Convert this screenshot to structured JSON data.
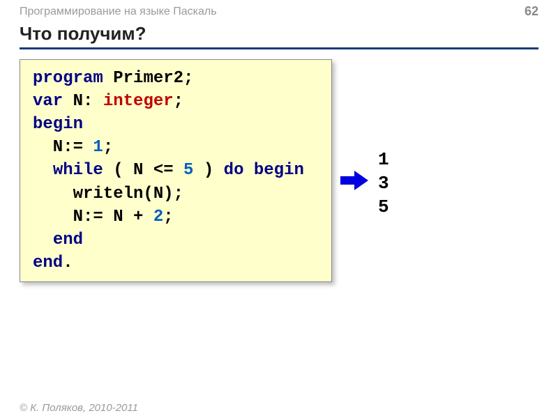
{
  "header": {
    "subject": "Программирование на языке Паскаль",
    "page": "62"
  },
  "title": "Что получим?",
  "code": {
    "l1_kw": "program",
    "l1_rest": " Primer2;",
    "l2_kw": "var",
    "l2_mid": " N: ",
    "l2_type": "integer",
    "l2_end": ";",
    "l3_kw": "begin",
    "l4_pre": "  N:= ",
    "l4_num": "1",
    "l4_end": ";",
    "l5_pre": "  ",
    "l5_kw1": "while",
    "l5_mid1": " ( N <= ",
    "l5_num": "5",
    "l5_mid2": " ) ",
    "l5_kw2": "do begin",
    "l6": "    writeln(N);",
    "l7_pre": "    N:= N + ",
    "l7_num": "2",
    "l7_end": ";",
    "l8_pre": "  ",
    "l8_kw": "end",
    "l9_kw": "end",
    "l9_end": "."
  },
  "output": {
    "line1": "1",
    "line2": "3",
    "line3": "5"
  },
  "footer": "© К. Поляков, 2010-2011"
}
